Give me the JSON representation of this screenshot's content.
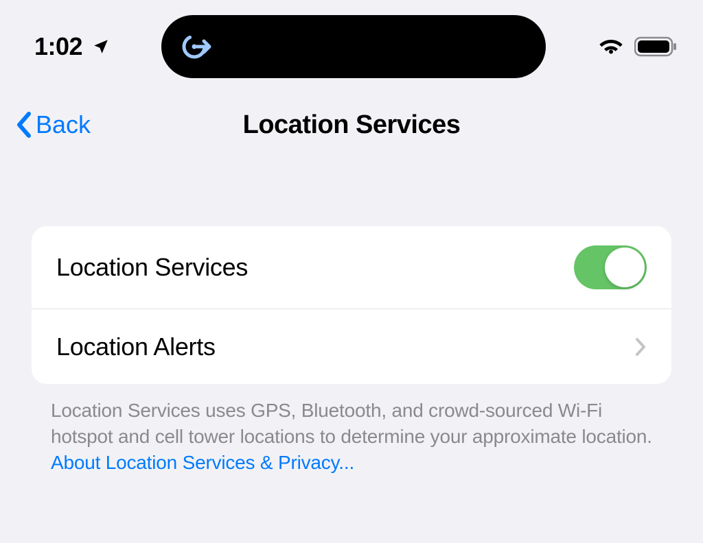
{
  "status_bar": {
    "time": "1:02"
  },
  "nav": {
    "back_label": "Back",
    "title": "Location Services"
  },
  "settings": {
    "rows": [
      {
        "label": "Location Services",
        "type": "toggle",
        "value": true
      },
      {
        "label": "Location Alerts",
        "type": "nav"
      }
    ]
  },
  "footer": {
    "text": "Location Services uses GPS, Bluetooth, and crowd-sourced Wi-Fi hotspot and cell tower locations to determine your approximate location. ",
    "link_text": "About Location Services & Privacy..."
  },
  "colors": {
    "accent": "#007aff",
    "toggle_on": "#65c466",
    "background": "#f2f2f6",
    "text_secondary": "#8a8a8e"
  }
}
